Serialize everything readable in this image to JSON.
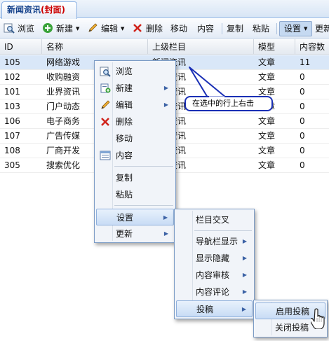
{
  "tab": {
    "title": "新闻资讯",
    "title_suffix": "(封面)"
  },
  "toolbar": {
    "browse": "浏览",
    "new": "新建",
    "edit": "编辑",
    "delete": "删除",
    "move": "移动",
    "content": "内容",
    "copy": "复制",
    "paste": "粘贴",
    "settings": "设置",
    "more": "更新"
  },
  "grid": {
    "headers": [
      "ID",
      "名称",
      "上级栏目",
      "模型",
      "内容数"
    ],
    "rows": [
      {
        "id": "105",
        "name": "网络游戏",
        "parent": "新闻资讯",
        "model": "文章",
        "count": "11"
      },
      {
        "id": "102",
        "name": "收购融资",
        "parent": "新闻资讯",
        "model": "文章",
        "count": "0"
      },
      {
        "id": "101",
        "name": "业界资讯",
        "parent": "新闻资讯",
        "model": "文章",
        "count": "0"
      },
      {
        "id": "103",
        "name": "门户动态",
        "parent": "新闻资讯",
        "model": "文章",
        "count": "0"
      },
      {
        "id": "106",
        "name": "电子商务",
        "parent": "新闻资讯",
        "model": "文章",
        "count": "0"
      },
      {
        "id": "107",
        "name": "广告传媒",
        "parent": "新闻资讯",
        "model": "文章",
        "count": "0"
      },
      {
        "id": "108",
        "name": "厂商开发",
        "parent": "新闻资讯",
        "model": "文章",
        "count": "0"
      },
      {
        "id": "305",
        "name": "搜索优化",
        "parent": "新闻资讯",
        "model": "文章",
        "count": "0"
      }
    ]
  },
  "context_menu": {
    "browse": "浏览",
    "new": "新建",
    "edit": "编辑",
    "delete": "删除",
    "move": "移动",
    "content": "内容",
    "copy": "复制",
    "paste": "粘贴",
    "settings": "设置",
    "refresh": "更新"
  },
  "settings_menu": {
    "cross": "栏目交叉",
    "nav": "导航栏显示",
    "hide": "显示隐藏",
    "audit": "内容审核",
    "comment": "内容评论",
    "contribute": "投稿"
  },
  "contribute_menu": {
    "enable": "启用投稿",
    "disable": "关闭投稿"
  },
  "callout": {
    "text": "在选中的行上右击"
  },
  "colors": {
    "accent": "#15428b",
    "selected_row": "#d9e7f8",
    "callout_border": "#1a2fb5",
    "menu_hover": "#c8dcf5"
  }
}
